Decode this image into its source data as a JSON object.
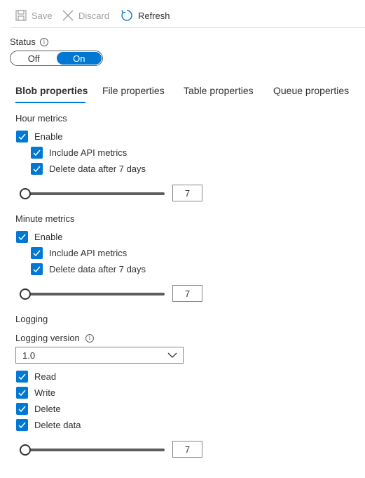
{
  "toolbar": {
    "save_label": "Save",
    "discard_label": "Discard",
    "refresh_label": "Refresh"
  },
  "status": {
    "label": "Status",
    "off_label": "Off",
    "on_label": "On",
    "selected": "On"
  },
  "tabs": [
    {
      "label": "Blob properties",
      "active": true
    },
    {
      "label": "File properties",
      "active": false
    },
    {
      "label": "Table properties",
      "active": false
    },
    {
      "label": "Queue properties",
      "active": false
    }
  ],
  "hour_metrics": {
    "title": "Hour metrics",
    "enable_label": "Enable",
    "include_api_label": "Include API metrics",
    "delete_after_label": "Delete data after 7 days",
    "retention_value": "7"
  },
  "minute_metrics": {
    "title": "Minute metrics",
    "enable_label": "Enable",
    "include_api_label": "Include API metrics",
    "delete_after_label": "Delete data after 7 days",
    "retention_value": "7"
  },
  "logging": {
    "title": "Logging",
    "version_label": "Logging version",
    "version_value": "1.0",
    "read_label": "Read",
    "write_label": "Write",
    "delete_label": "Delete",
    "delete_data_label": "Delete data",
    "retention_value": "7"
  },
  "colors": {
    "accent": "#0078d4",
    "text": "#323130",
    "disabled": "#a19f9d"
  }
}
